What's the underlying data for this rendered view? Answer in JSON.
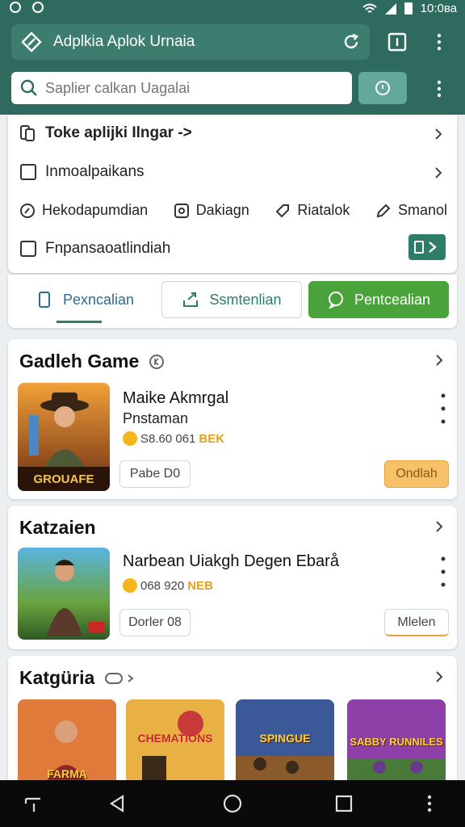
{
  "statusbar": {
    "time": "10:0ва"
  },
  "header": {
    "url_title": "Adplkia Aplok Urnaia",
    "search_placeholder": "Saplier calkan Uagalai"
  },
  "menu": {
    "row1": "Toke aplijki Ilngar ->",
    "row2": "Inmoalpaikans",
    "chips": [
      "Hekodapumdian",
      "Dakiagn",
      "Riatalok",
      "Smanol"
    ],
    "row4": "Fnpansaoatlindiah"
  },
  "tabs": [
    "Pexncalian",
    "Ssmtenlian",
    "Pentcealian"
  ],
  "section1": {
    "title": "Gadleh Game",
    "game_title": "Maike Akmrgal",
    "game_sub": "Pnstaman",
    "price": "S8.60 061",
    "price_tag": "BEK",
    "secondary_btn": "Pabe D0",
    "primary_btn": "Ondlah",
    "thumb_caption": "GROUAFE"
  },
  "section2": {
    "title": "Katzaien",
    "game_title": "Narbean Uiakgh Degen Ebarå",
    "price": "068 920",
    "price_tag": "NEB",
    "secondary_btn": "Dorler 08",
    "primary_btn": "Mlelen"
  },
  "section3": {
    "title": "Katgüria",
    "categories": [
      "FARMA",
      "CHEMATIONS",
      "SPINGUE",
      "SABBY RUNNILES"
    ]
  },
  "colors": {
    "primary": "#2e6b5e",
    "accent": "#4aa33a",
    "orange": "#f7c169"
  }
}
